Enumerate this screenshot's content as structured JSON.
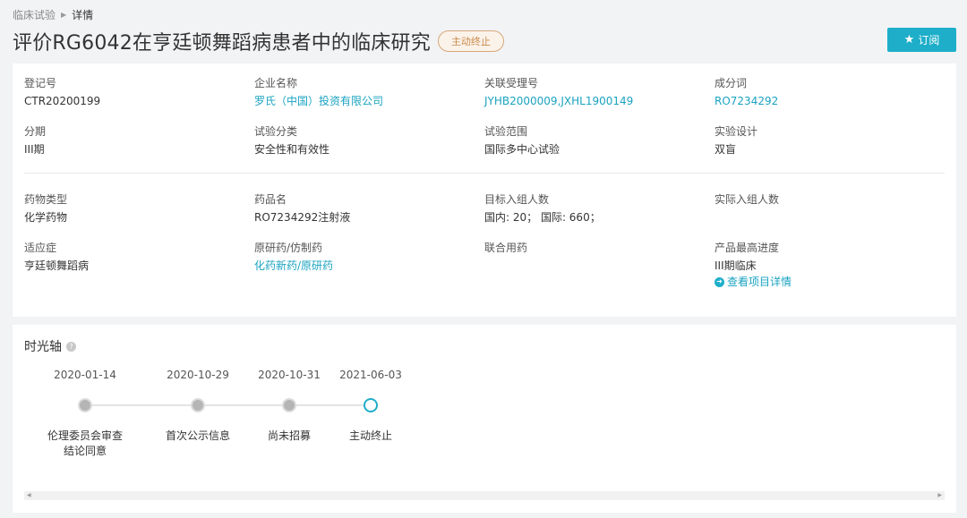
{
  "breadcrumb": {
    "root": "临床试验",
    "current": "详情"
  },
  "title": "评价RG6042在亨廷顿舞蹈病患者中的临床研究",
  "status_badge": "主动终止",
  "subscribe": {
    "label": "订阅",
    "icon": "star-icon"
  },
  "info_top": [
    {
      "label": "登记号",
      "value": "CTR20200199",
      "link": false
    },
    {
      "label": "企业名称",
      "value": "罗氏（中国）投资有限公司",
      "link": true
    },
    {
      "label": "关联受理号",
      "value": "JYHB2000009,JXHL1900149",
      "link": true
    },
    {
      "label": "成分词",
      "value": "RO7234292",
      "link": true
    },
    {
      "label": "分期",
      "value": "III期",
      "link": false
    },
    {
      "label": "试验分类",
      "value": "安全性和有效性",
      "link": false
    },
    {
      "label": "试验范围",
      "value": "国际多中心试验",
      "link": false
    },
    {
      "label": "实验设计",
      "value": "双盲",
      "link": false
    }
  ],
  "info_bottom": [
    {
      "label": "药物类型",
      "value": "化学药物",
      "link": false
    },
    {
      "label": "药品名",
      "value": "RO7234292注射液",
      "link": false
    },
    {
      "label": "目标入组人数",
      "value": "国内: 20；  国际: 660；",
      "link": false
    },
    {
      "label": "实际入组人数",
      "value": "",
      "link": false
    },
    {
      "label": "适应症",
      "value": "亨廷顿舞蹈病",
      "link": false
    },
    {
      "label": "原研药/仿制药",
      "value": "化药新药/原研药",
      "link": true
    },
    {
      "label": "联合用药",
      "value": "",
      "link": false
    },
    {
      "label": "产品最高进度",
      "value": "III期临床",
      "link": false
    }
  ],
  "project_link": "查看项目详情",
  "timeline": {
    "title": "时光轴",
    "events": [
      {
        "date": "2020-01-14",
        "label": "伦理委员会审查结论同意",
        "active": false
      },
      {
        "date": "2020-10-29",
        "label": "首次公示信息",
        "active": false
      },
      {
        "date": "2020-10-31",
        "label": "尚未招募",
        "active": false
      },
      {
        "date": "2021-06-03",
        "label": "主动终止",
        "active": true
      }
    ]
  }
}
